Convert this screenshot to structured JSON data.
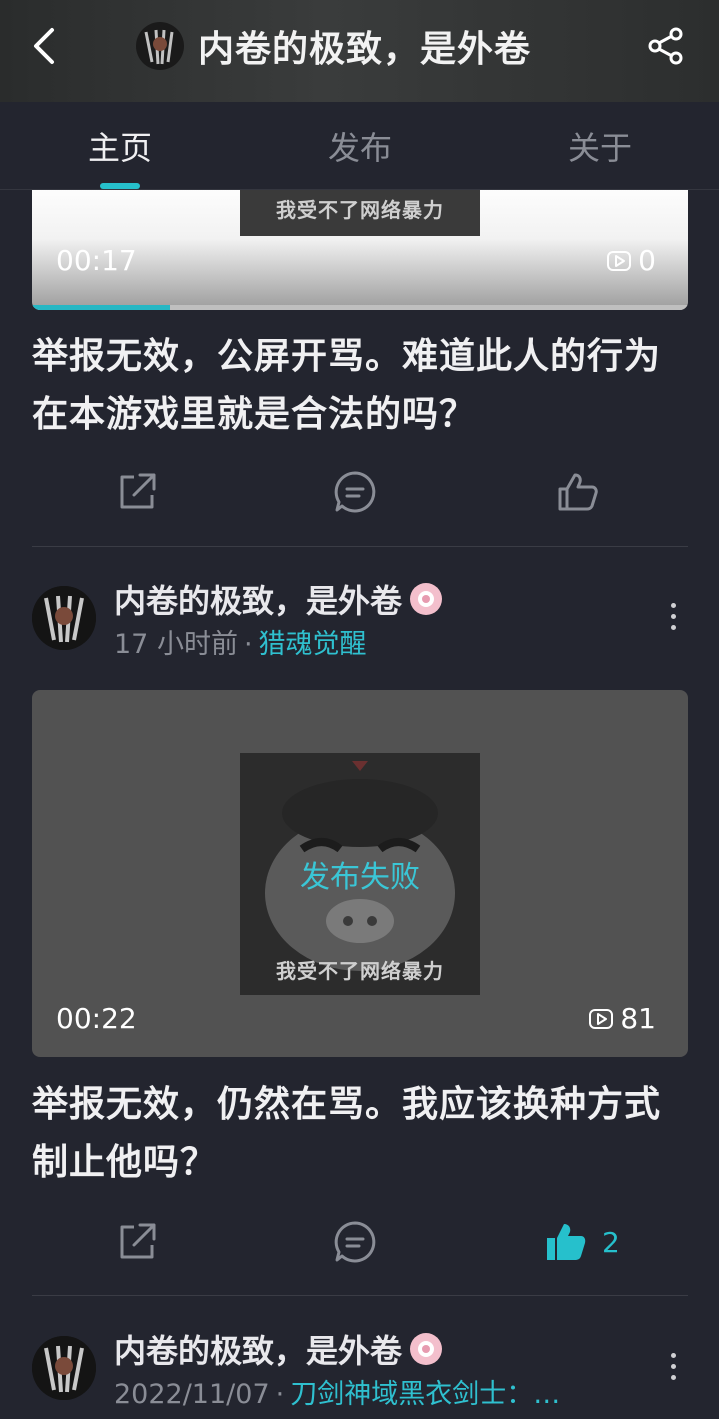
{
  "header": {
    "title": "内卷的极致，是外卷"
  },
  "tabs": [
    {
      "label": "主页",
      "active": true
    },
    {
      "label": "发布",
      "active": false
    },
    {
      "label": "关于",
      "active": false
    }
  ],
  "colors": {
    "accent": "#26c0cc",
    "background": "#23252f"
  },
  "posts": [
    {
      "video": {
        "caption": "我受不了网络暴力",
        "duration": "00:17",
        "views": "0",
        "progress": 0.21
      },
      "title": "举报无效，公屏开骂。难道此人的行为在本游戏里就是合法的吗？",
      "liked": false
    },
    {
      "author": "内卷的极致，是外卷",
      "time": "17 小时前",
      "separator": "·",
      "topic": "猎魂觉醒",
      "video": {
        "caption": "我受不了网络暴力",
        "status": "发布失败",
        "duration": "00:22",
        "views": "81"
      },
      "title": "举报无效，仍然在骂。我应该换种方式制止他吗？",
      "liked": true,
      "likes": "2"
    },
    {
      "author": "内卷的极致，是外卷",
      "time": "2022/11/07",
      "separator": "·",
      "topic": "刀剑神域黑衣剑士：…"
    }
  ],
  "icons": [
    "back-arrow-icon",
    "share-icon",
    "external-share-icon",
    "comment-icon",
    "like-icon",
    "video-view-icon",
    "more-icon"
  ]
}
